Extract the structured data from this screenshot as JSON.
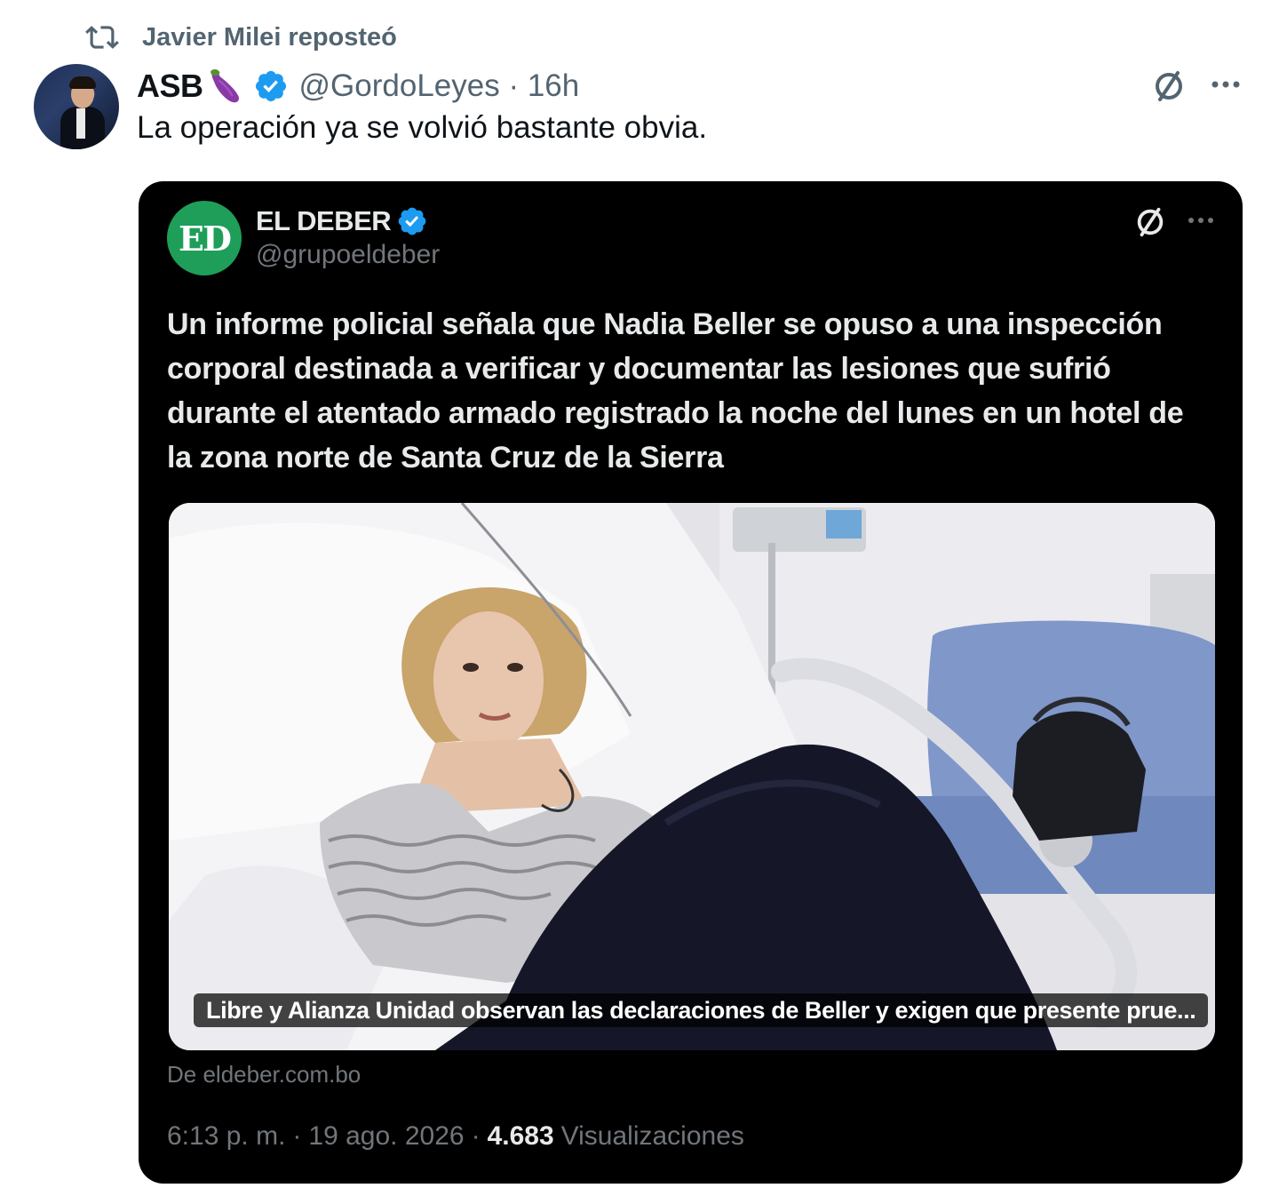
{
  "repost": {
    "text": "Javier Milei reposteó",
    "icon": "repost-icon"
  },
  "tweet": {
    "display_name": "ASB",
    "emoji": "eggplant-emoji",
    "verified": true,
    "handle": "@GordoLeyes",
    "separator": "·",
    "time": "16h",
    "text": "La operación ya se volvió bastante obvia."
  },
  "quoted": {
    "avatar_text": "ED",
    "name": "EL DEBER",
    "verified": true,
    "handle": "@grupoeldeber",
    "text": "Un informe policial señala que Nadia Beller se opuso a una inspección corporal destinada a verificar y documentar las lesiones que sufrió durante el atentado armado registrado la noche del lunes en un hotel de la zona norte de Santa Cruz de la Sierra",
    "media_caption": "Libre y Alianza Unidad observan las declaraciones de Beller y exigen que presente prue...",
    "source": "De eldeber.com.bo",
    "time": "6:13 p. m.",
    "date": "19 ago. 2026",
    "separator": "·",
    "views_count": "4.683",
    "views_label": "Visualizaciones"
  },
  "colors": {
    "verified": "#1d9bf0",
    "muted": "#536471",
    "card_bg": "#000000",
    "ed_green": "#1e9e59"
  }
}
